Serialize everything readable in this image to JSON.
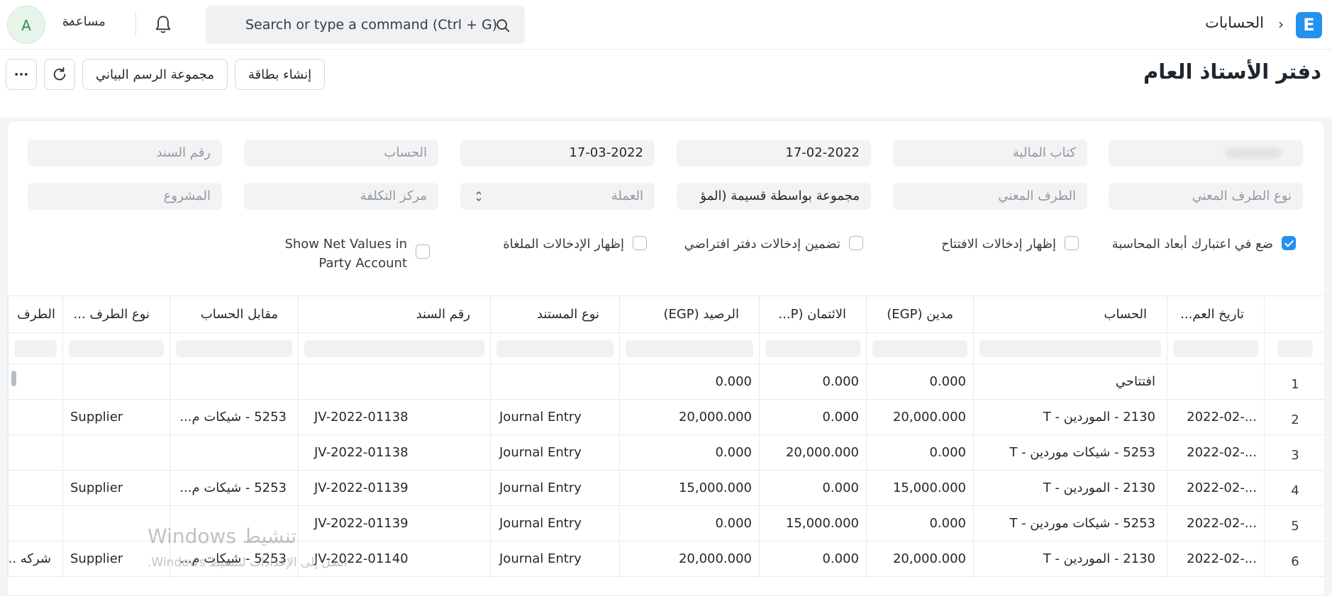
{
  "topbar": {
    "logo_letter": "E",
    "breadcrumb": "الحسابات",
    "search_placeholder": "Search or type a command (Ctrl + G)",
    "help_label": "مساعدة",
    "avatar_letter": "A"
  },
  "page": {
    "title": "دفتر الأستاذ العام",
    "buttons": {
      "create_card": "إنشاء بطاقة",
      "chart_group": "مجموعة الرسم البياني",
      "more": "···"
    }
  },
  "filters": {
    "row1": {
      "company": "",
      "finance_book": "كتاب المالية",
      "from_date": "17-02-2022",
      "to_date": "17-03-2022",
      "account": "الحساب",
      "voucher_no": "رقم السند"
    },
    "row2": {
      "party_type": "نوع الطرف المعني",
      "party": "الطرف المعني",
      "group_by": "مجموعة بواسطة قسيمة (المؤ",
      "currency": "العملة",
      "cost_center": "مركز التكلفة",
      "project": "المشروع"
    },
    "checkboxes": [
      {
        "label": "ضع في اعتبارك أبعاد المحاسبة",
        "checked": true
      },
      {
        "label": "إظهار إدخالات الافتتاح",
        "checked": false
      },
      {
        "label": "تضمين إدخالات دفتر افتراضي",
        "checked": false
      },
      {
        "label": "إظهار الإدخالات الملغاة",
        "checked": false
      },
      {
        "label": "Show Net Values in Party Account",
        "checked": false
      }
    ]
  },
  "table": {
    "columns": [
      "تاريخ العم...",
      "الحساب",
      "مدين (EGP)",
      "الائتمان (P...",
      "الرصيد (EGP)",
      "نوع المستند",
      "رقم السند",
      "مقابل الحساب",
      "نوع الطرف ...",
      "الطرف"
    ],
    "rows": [
      {
        "n": "1",
        "date": "",
        "account": "افتتاحي",
        "debit": "0.000",
        "credit": "0.000",
        "balance": "0.000",
        "doctype": "",
        "voucher": "",
        "against": "",
        "party_type": "",
        "party": ""
      },
      {
        "n": "2",
        "date": "2022-02-...",
        "account": "2130 - الموردين - T",
        "debit": "20,000.000",
        "credit": "0.000",
        "balance": "20,000.000",
        "doctype": "Journal Entry",
        "voucher": "JV-2022-01138",
        "against": "5253 - شيكات م...",
        "party_type": "Supplier",
        "party": ""
      },
      {
        "n": "3",
        "date": "2022-02-...",
        "account": "5253 - شيكات موردين - T",
        "debit": "0.000",
        "credit": "20,000.000",
        "balance": "0.000",
        "doctype": "Journal Entry",
        "voucher": "JV-2022-01138",
        "against": "",
        "party_type": "",
        "party": ""
      },
      {
        "n": "4",
        "date": "2022-02-...",
        "account": "2130 - الموردين - T",
        "debit": "15,000.000",
        "credit": "0.000",
        "balance": "15,000.000",
        "doctype": "Journal Entry",
        "voucher": "JV-2022-01139",
        "against": "5253 - شيكات م...",
        "party_type": "Supplier",
        "party": ""
      },
      {
        "n": "5",
        "date": "2022-02-...",
        "account": "5253 - شيكات موردين - T",
        "debit": "0.000",
        "credit": "15,000.000",
        "balance": "0.000",
        "doctype": "Journal Entry",
        "voucher": "JV-2022-01139",
        "against": "",
        "party_type": "",
        "party": ""
      },
      {
        "n": "6",
        "date": "2022-02-...",
        "account": "2130 - الموردين - T",
        "debit": "20,000.000",
        "credit": "0.000",
        "balance": "20,000.000",
        "doctype": "Journal Entry",
        "voucher": "JV-2022-01140",
        "against": "5253 - شيكات م...",
        "party_type": "Supplier",
        "party": "شركه ..."
      }
    ]
  },
  "watermark": {
    "line1": "تنشيط Windows",
    "line2": "انتقل إلى الإعدادات لتنشيط Windows."
  }
}
